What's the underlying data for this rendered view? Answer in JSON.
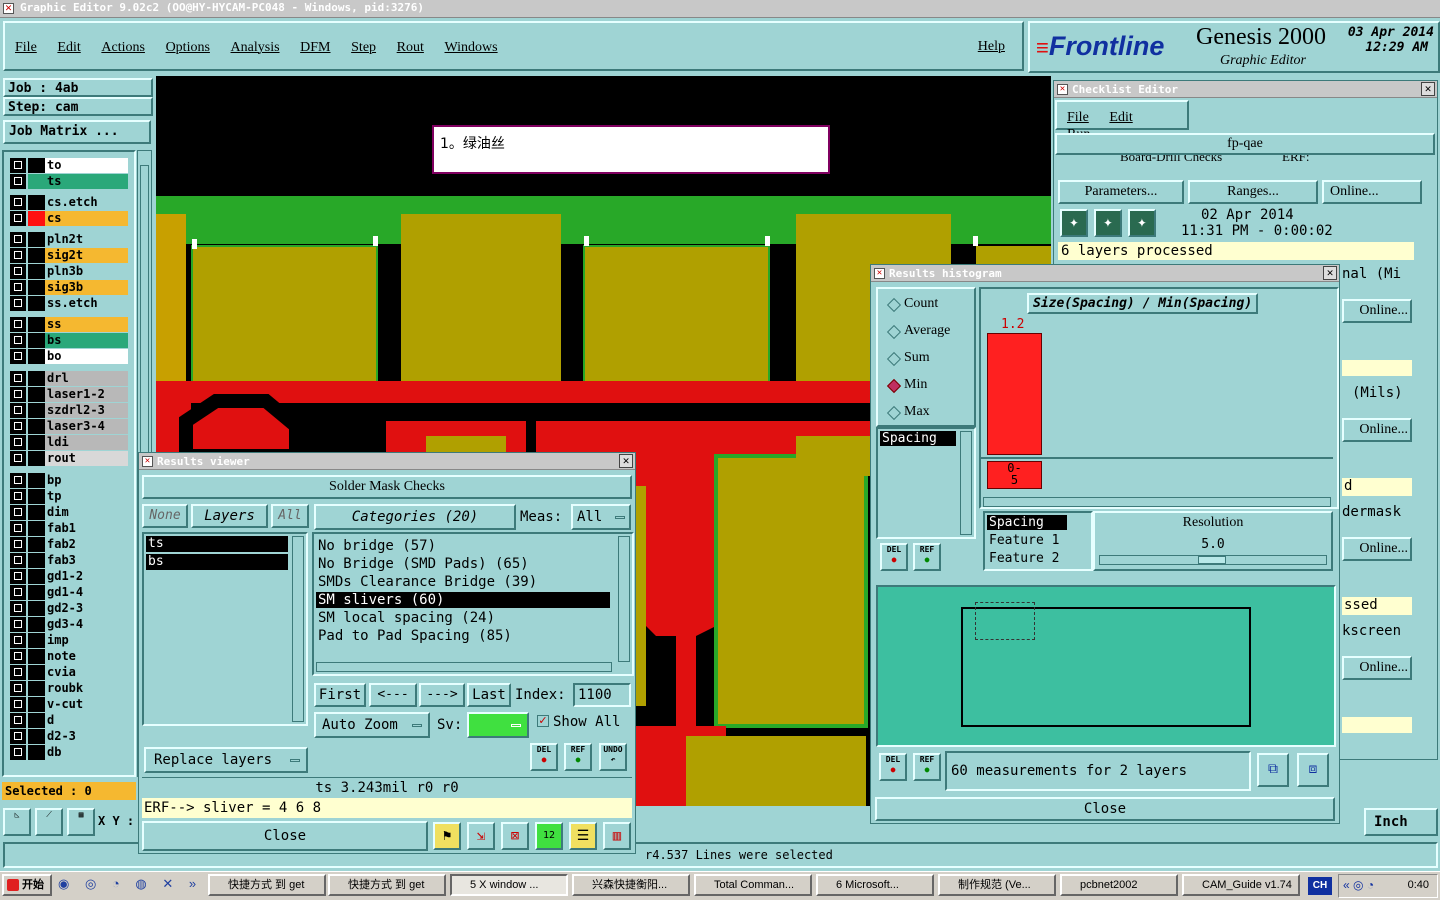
{
  "window_title": "Graphic Editor 9.02c2 (OO@HY-HYCAM-PC048 - Windows, pid:3276)",
  "menu": [
    "File",
    "Edit",
    "Actions",
    "Options",
    "Analysis",
    "DFM",
    "Step",
    "Rout",
    "Windows"
  ],
  "help": "Help",
  "brand": {
    "logo": "Frontline",
    "product": "Genesis 2000",
    "subtitle": "Graphic Editor",
    "date": "03 Apr 2014",
    "time": "12:29 AM"
  },
  "job": {
    "job": "Job : 4ab",
    "step": "Step: cam",
    "matrix": "Job Matrix ..."
  },
  "layers": [
    {
      "name": "to",
      "color": "#ffffff",
      "sw": "#000000"
    },
    {
      "name": "ts",
      "color": "#2aa87a",
      "sw": "#2aa87a"
    },
    {
      "name": "cs.etch",
      "color": "#9fd4d4",
      "sw": "#000000"
    },
    {
      "name": "cs",
      "color": "#f5b830",
      "sw": "#ff1010"
    },
    {
      "name": "pln2t",
      "color": "#9fd4d4",
      "sw": "#000000"
    },
    {
      "name": "sig2t",
      "color": "#f5b830",
      "sw": "#000000"
    },
    {
      "name": "pln3b",
      "color": "#9fd4d4",
      "sw": "#000000"
    },
    {
      "name": "sig3b",
      "color": "#f5b830",
      "sw": "#000000"
    },
    {
      "name": "ss.etch",
      "color": "#9fd4d4",
      "sw": "#000000"
    },
    {
      "name": "ss",
      "color": "#f5b830",
      "sw": "#000000"
    },
    {
      "name": "bs",
      "color": "#2aa87a",
      "sw": "#000000"
    },
    {
      "name": "bo",
      "color": "#ffffff",
      "sw": "#000000"
    },
    {
      "name": "drl",
      "color": "#b8b8b8",
      "sw": "#000000"
    },
    {
      "name": "laser1-2",
      "color": "#b8b8b8",
      "sw": "#000000"
    },
    {
      "name": "szdrl2-3",
      "color": "#b8b8b8",
      "sw": "#000000"
    },
    {
      "name": "laser3-4",
      "color": "#b8b8b8",
      "sw": "#000000"
    },
    {
      "name": "ldi",
      "color": "#b8b8b8",
      "sw": "#000000"
    },
    {
      "name": "rout",
      "color": "#d8d8d8",
      "sw": "#000000"
    },
    {
      "name": "bp",
      "color": "#9fd4d4",
      "sw": "#000000"
    },
    {
      "name": "tp",
      "color": "#9fd4d4",
      "sw": "#000000"
    },
    {
      "name": "dim",
      "color": "#9fd4d4",
      "sw": "#000000"
    },
    {
      "name": "fab1",
      "color": "#9fd4d4",
      "sw": "#000000"
    },
    {
      "name": "fab2",
      "color": "#9fd4d4",
      "sw": "#000000"
    },
    {
      "name": "fab3",
      "color": "#9fd4d4",
      "sw": "#000000"
    },
    {
      "name": "gd1-2",
      "color": "#9fd4d4",
      "sw": "#000000"
    },
    {
      "name": "gd1-4",
      "color": "#9fd4d4",
      "sw": "#000000"
    },
    {
      "name": "gd2-3",
      "color": "#9fd4d4",
      "sw": "#000000"
    },
    {
      "name": "gd3-4",
      "color": "#9fd4d4",
      "sw": "#000000"
    },
    {
      "name": "imp",
      "color": "#9fd4d4",
      "sw": "#000000"
    },
    {
      "name": "note",
      "color": "#9fd4d4",
      "sw": "#000000"
    },
    {
      "name": "cvia",
      "color": "#9fd4d4",
      "sw": "#000000"
    },
    {
      "name": "roubk",
      "color": "#9fd4d4",
      "sw": "#000000"
    },
    {
      "name": "v-cut",
      "color": "#9fd4d4",
      "sw": "#000000"
    },
    {
      "name": "d",
      "color": "#9fd4d4",
      "sw": "#000000"
    },
    {
      "name": "d2-3",
      "color": "#9fd4d4",
      "sw": "#000000"
    },
    {
      "name": "db",
      "color": "#9fd4d4",
      "sw": "#000000"
    }
  ],
  "selected": "Selected : 0",
  "xy_label": "X Y :",
  "units": "Inch",
  "status_line": "r4.537 Lines were selected",
  "canvas_note": "1。绿油丝",
  "checklist": {
    "title": "Checklist Editor",
    "menu": [
      "File",
      "Edit",
      "Run"
    ],
    "name": "fp-qae",
    "row_top": "Board-Drill Checks",
    "erf": "ERF:",
    "buttons": [
      "Parameters...",
      "Ranges...",
      "Online..."
    ],
    "date": "02 Apr 2014",
    "time": "11:31 PM - 0:00:02",
    "processed": "6 layers processed",
    "side_texts": [
      "nal (Mi",
      "Online...",
      "(Mils)",
      "Online...",
      "d",
      "dermask",
      "Online...",
      "ssed",
      "kscreen",
      "Online..."
    ]
  },
  "histogram": {
    "title": "Results histogram",
    "modes": [
      "Count",
      "Average",
      "Sum",
      "Min",
      "Max"
    ],
    "selected_mode": "Min",
    "list_item": "Spacing",
    "chart_title": "Size(Spacing) / Min(Spacing)",
    "bar_label": "1.2",
    "bin_label_a": "0-",
    "bin_label_b": "5",
    "res_items": [
      "Spacing",
      "Feature 1",
      "Feature 2"
    ],
    "resolution_label": "Resolution",
    "resolution_value": "5.0",
    "measurements": "60 measurements for 2 layers",
    "close": "Close",
    "del": "DEL",
    "ref": "REF"
  },
  "results": {
    "title": "Results viewer",
    "header": "Solder Mask Checks",
    "tabs": [
      "None",
      "Layers",
      "All"
    ],
    "categories_label": "Categories (20)",
    "meas_label": "Meas:",
    "meas_value": "All",
    "layers": [
      "ts",
      "bs"
    ],
    "categories": [
      "No bridge (57)",
      "No Bridge (SMD Pads) (65)",
      "SMDs Clearance Bridge (39)",
      "SM slivers (60)",
      "SM local spacing (24)",
      "Pad to Pad Spacing (85)"
    ],
    "selected_category": "SM slivers (60)",
    "nav": [
      "First",
      "<---",
      "--->",
      "Last"
    ],
    "index_label": "Index:",
    "index_value": "1100",
    "auto_zoom": "Auto Zoom",
    "sv_label": "Sv:",
    "show_all": "Show All",
    "replace_layers": "Replace layers",
    "info_line": "ts 3.243mil  r0  r0",
    "erf_line": "ERF--> sliver = 4 6 8",
    "close": "Close",
    "del": "DEL",
    "ref": "REF",
    "undo": "UNDO"
  },
  "taskbar": {
    "start": "开始",
    "items": [
      "快捷方式 到 get",
      "快捷方式 到 get",
      "5 X window ...",
      "兴森快捷衡阳...",
      "Total Comman...",
      "6 Microsoft...",
      "制作规范 (Ve...",
      "pcbnet2002",
      "CAM_Guide v1.74"
    ],
    "lang": "CH",
    "clock": "0:40"
  }
}
